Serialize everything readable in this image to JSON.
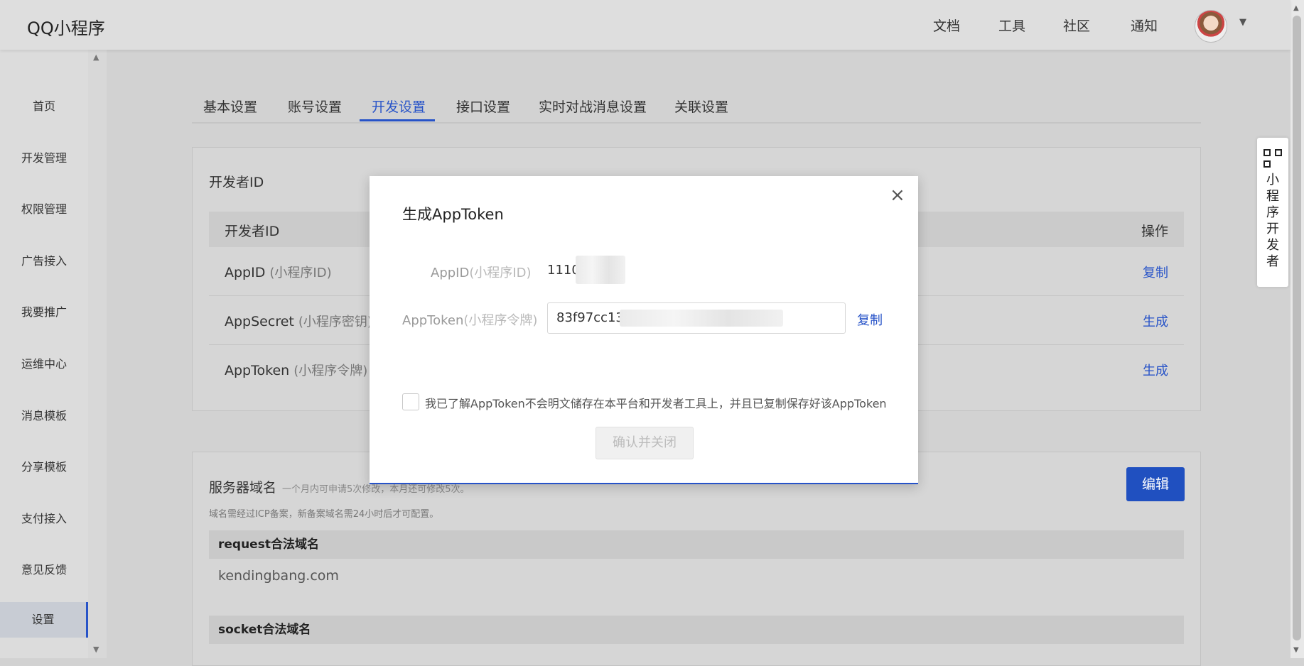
{
  "header": {
    "logo": "QQ小程序",
    "nav": [
      "文档",
      "工具",
      "社区",
      "通知"
    ]
  },
  "sidebar": {
    "items": [
      "首页",
      "开发管理",
      "权限管理",
      "广告接入",
      "我要推广",
      "运维中心",
      "消息模板",
      "分享模板",
      "支付接入",
      "意见反馈",
      "设置"
    ],
    "active": "设置"
  },
  "tabs": [
    "基本设置",
    "账号设置",
    "开发设置",
    "接口设置",
    "实时对战消息设置",
    "关联设置"
  ],
  "active_tab": "开发设置",
  "developer_panel": {
    "title": "开发者ID",
    "col_id": "开发者ID",
    "col_action": "操作",
    "rows": [
      {
        "key": "AppID",
        "hint": "(小程序ID)",
        "action": "复制"
      },
      {
        "key": "AppSecret",
        "hint": "(小程序密钥)",
        "action": "生成"
      },
      {
        "key": "AppToken",
        "hint": "(小程序令牌)",
        "action": "生成"
      }
    ]
  },
  "server_panel": {
    "title": "服务器域名",
    "subtitle": "一个月内可申请5次修改，本月还可修改5次。",
    "note": "域名需经过ICP备案，新备案域名需24小时后才可配置。",
    "edit_label": "编辑",
    "request_label": "request合法域名",
    "request_value": "kendingbang.com",
    "socket_label": "socket合法域名"
  },
  "dev_float": {
    "label": "小程序开发者"
  },
  "modal": {
    "title": "生成AppToken",
    "appid_label": "AppID",
    "appid_hint": "(小程序ID)",
    "appid_value": "1110",
    "token_label": "AppToken",
    "token_hint": "(小程序令牌)",
    "token_value": "83f97cc13",
    "copy_label": "复制",
    "checkbox_text": "我已了解AppToken不会明文储存在本平台和开发者工具上，并且已复制保存好该AppToken",
    "confirm_label": "确认并关闭",
    "close_icon": "×"
  },
  "colors": {
    "accent": "#2753c8",
    "button": "#2050c0"
  }
}
